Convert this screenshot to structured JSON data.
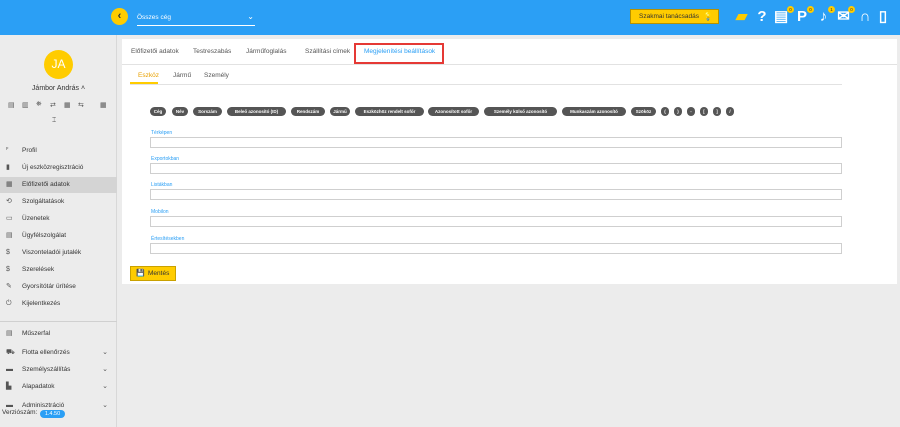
{
  "topbar": {
    "company": "Összes cég",
    "advice_label": "Szakmai tanácsadás",
    "badges": {
      "help": "",
      "doc": "0",
      "park": "0",
      "bell": "1",
      "msg": "0",
      "chat": "0"
    }
  },
  "sidebar": {
    "avatar_initials": "JA",
    "user_name": "Jámbor András",
    "items": [
      {
        "icon": "ꟳ",
        "label": "Profil"
      },
      {
        "icon": "▮",
        "label": "Új eszközregisztráció"
      },
      {
        "icon": "▦",
        "label": "Előfizetői adatok"
      },
      {
        "icon": "⟲",
        "label": "Szolgáltatások"
      },
      {
        "icon": "▭",
        "label": "Üzenetek"
      },
      {
        "icon": "▤",
        "label": "Ügyfélszolgálat"
      },
      {
        "icon": "$",
        "label": "Viszonteladói jutalék"
      },
      {
        "icon": "$",
        "label": "Szerelések"
      },
      {
        "icon": "✎",
        "label": "Gyorsítótár ürítése"
      },
      {
        "icon": "⏻",
        "label": "Kijelentkezés"
      },
      {
        "icon": "▤",
        "label": "Műszerfal"
      },
      {
        "icon": "⛟",
        "label": "Flotta ellenőrzés"
      },
      {
        "icon": "▬",
        "label": "Személyszállítás"
      },
      {
        "icon": "▙",
        "label": "Alapadatok"
      },
      {
        "icon": "▬",
        "label": "Adminisztráció"
      }
    ],
    "version_label": "Verziószám:",
    "version_value": "1.4.50"
  },
  "tabs": [
    "Előfizetői adatok",
    "Testreszabás",
    "Járműfoglalás",
    "Szállítási címek",
    "Megjelenítési beállítások"
  ],
  "subtabs": [
    "Eszköz",
    "Jármű",
    "Személy"
  ],
  "chips": [
    "Cég",
    "Név",
    "Sorszám",
    "Beleő azonosító (ID)",
    "Rendszám",
    "Jármű",
    "Eszközhöz rendelt sofőr",
    "Azonosított sofőr",
    "Személy külső azonosító",
    "Munkaszám azonosító",
    "Szököz",
    "(",
    ")",
    "-",
    "[",
    "]",
    "/"
  ],
  "fields": [
    {
      "label": "Térképen",
      "value": ""
    },
    {
      "label": "Exportokban",
      "value": ""
    },
    {
      "label": "Listákban",
      "value": ""
    },
    {
      "label": "Mobilon",
      "value": ""
    },
    {
      "label": "Értesítésekben",
      "value": ""
    }
  ],
  "save_label": "Mentés",
  "colors": {
    "topbar": "#2b9ff5",
    "accent": "#ffcc00",
    "highlight": "#e53935"
  }
}
